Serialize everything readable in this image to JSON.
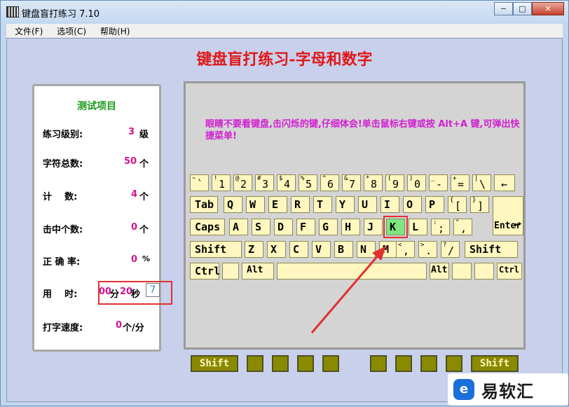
{
  "window": {
    "title": "键盘盲打练习 7.10",
    "min": "−",
    "max": "□",
    "close": "✕"
  },
  "menu": [
    "文件(F)",
    "选项(C)",
    "帮助(H)"
  ],
  "heading": "键盘盲打练习-字母和数字",
  "stats": {
    "title": "测试项目",
    "level_label": "练习级别:",
    "level_value": "3",
    "level_unit": "级",
    "total_label": "字符总数:",
    "total_value": "50",
    "total_unit": "个",
    "count_label": "计    数:",
    "count_value": "4",
    "count_unit": "个",
    "hit_label": "击中个数:",
    "hit_value": "0",
    "hit_unit": "个",
    "acc_label": "正 确 率:",
    "acc_value": "0",
    "acc_unit": "%",
    "time_label": "用    时:",
    "time_min": "00",
    "time_min_unit": "分",
    "time_sec": "20",
    "time_sec_unit": "秒",
    "time_input": "7",
    "speed_label": "打字速度:",
    "speed_value": "0",
    "speed_unit": "个/分"
  },
  "hint": "眼睛不要看键盘,击闪烁的键,仔细体会!单击鼠标右键或按 Alt+A 键,可弹出快捷菜单!",
  "keys": {
    "row1": [
      {
        "s": "~",
        "b": "`"
      },
      {
        "s": "!",
        "b": "1"
      },
      {
        "s": "@",
        "b": "2"
      },
      {
        "s": "#",
        "b": "3"
      },
      {
        "s": "$",
        "b": "4"
      },
      {
        "s": "%",
        "b": "5"
      },
      {
        "s": "^",
        "b": "6"
      },
      {
        "s": "&",
        "b": "7"
      },
      {
        "s": "*",
        "b": "8"
      },
      {
        "s": "(",
        "b": "9"
      },
      {
        "s": ")",
        "b": "0"
      },
      {
        "s": "_",
        "b": "-"
      },
      {
        "s": "+",
        "b": "="
      },
      {
        "s": "|",
        "b": "\\"
      },
      {
        "s": "",
        "b": "←"
      }
    ],
    "row2": [
      "Tab",
      "Q",
      "W",
      "E",
      "R",
      "T",
      "Y",
      "U",
      "I",
      "O",
      "P"
    ],
    "row2_punct": [
      {
        "s": "{",
        "b": "["
      },
      {
        "s": "}",
        "b": "]"
      }
    ],
    "enter": "Enter",
    "enter_arrow": "↵",
    "row3": [
      "Caps",
      "A",
      "S",
      "D",
      "F",
      "G",
      "H",
      "J",
      "K",
      "L"
    ],
    "row3_punct": [
      {
        "s": ":",
        "b": ";"
      },
      {
        "s": "\"",
        "b": ","
      }
    ],
    "row4": [
      "Shift",
      "Z",
      "X",
      "C",
      "V",
      "B",
      "N",
      "M"
    ],
    "row4_punct": [
      {
        "s": "<",
        "b": ","
      },
      {
        "s": ">",
        "b": "."
      },
      {
        "s": "?",
        "b": "/"
      }
    ],
    "row4_right": "Shift",
    "row5": {
      "ctrl_l": "Ctrl",
      "alt_l": "Alt",
      "alt_r": "Alt",
      "ctrl_r": "Ctrl"
    }
  },
  "highlight_key": "K",
  "bottom": {
    "shift_l": "Shift",
    "shift_r": "Shift"
  },
  "watermark": {
    "logo": "e",
    "text": "易软汇"
  },
  "colors": {
    "heading": "#e01818",
    "stats_title": "#1a9a1a",
    "value": "#d2148c",
    "hint": "#d020d0",
    "key": "#fff7bf",
    "highlight": "#7fe67f"
  }
}
